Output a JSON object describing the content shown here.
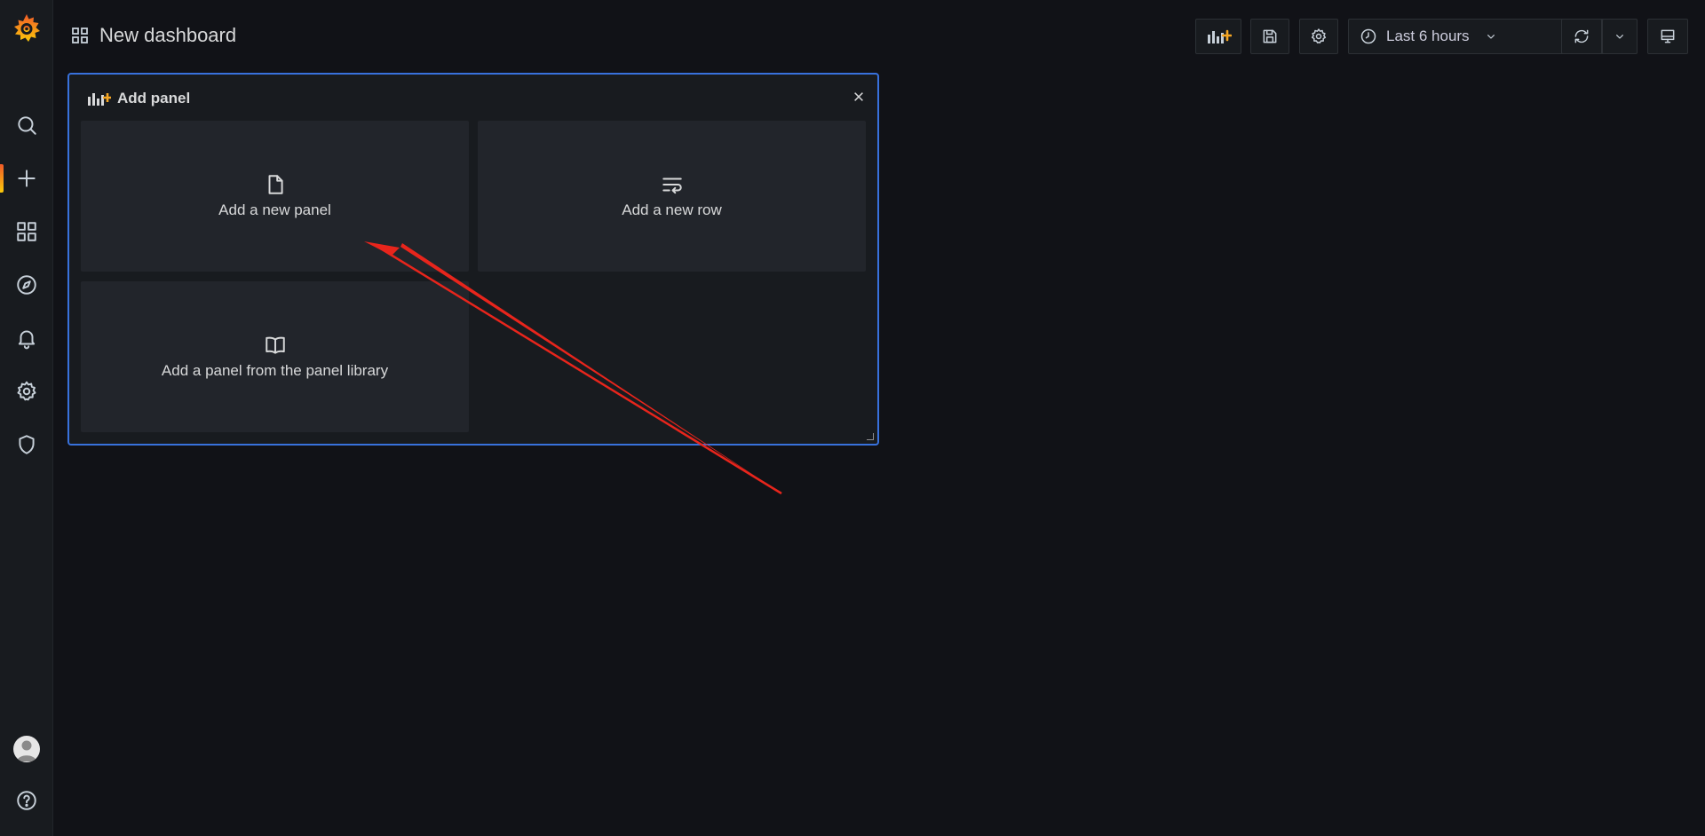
{
  "app": {
    "title": "New dashboard"
  },
  "sidebar": {
    "logo": "grafana-logo-icon",
    "items": [
      {
        "name": "search",
        "icon": "search-icon"
      },
      {
        "name": "create",
        "icon": "plus-icon",
        "active": true
      },
      {
        "name": "dashboards",
        "icon": "apps-icon"
      },
      {
        "name": "explore",
        "icon": "compass-icon"
      },
      {
        "name": "alerting",
        "icon": "bell-icon"
      },
      {
        "name": "configuration",
        "icon": "cog-icon"
      },
      {
        "name": "server-admin",
        "icon": "shield-icon"
      }
    ],
    "bottom": [
      {
        "name": "profile",
        "icon": "avatar-icon"
      },
      {
        "name": "help",
        "icon": "question-circle-icon"
      }
    ]
  },
  "toolbar": {
    "time_range": "Last 6 hours",
    "buttons": [
      "add-panel-icon",
      "save-icon",
      "cog-icon",
      "clock-icon",
      "zoom-out-icon",
      "sync-icon",
      "chevron-down-icon",
      "monitor-icon"
    ]
  },
  "add_panel": {
    "title": "Add panel",
    "options": [
      {
        "label": "Add a new panel",
        "icon": "file-blank-icon"
      },
      {
        "label": "Add a new row",
        "icon": "wrap-text-icon"
      },
      {
        "label": "Add a panel from the panel library",
        "icon": "book-open-icon"
      }
    ]
  },
  "colors": {
    "background": "#111217",
    "sidebar": "#181b1f",
    "panel_border": "#3871dc",
    "tile": "#22252b",
    "accent_orange": "#f05a28",
    "annotation_arrow": "#e8251c"
  }
}
